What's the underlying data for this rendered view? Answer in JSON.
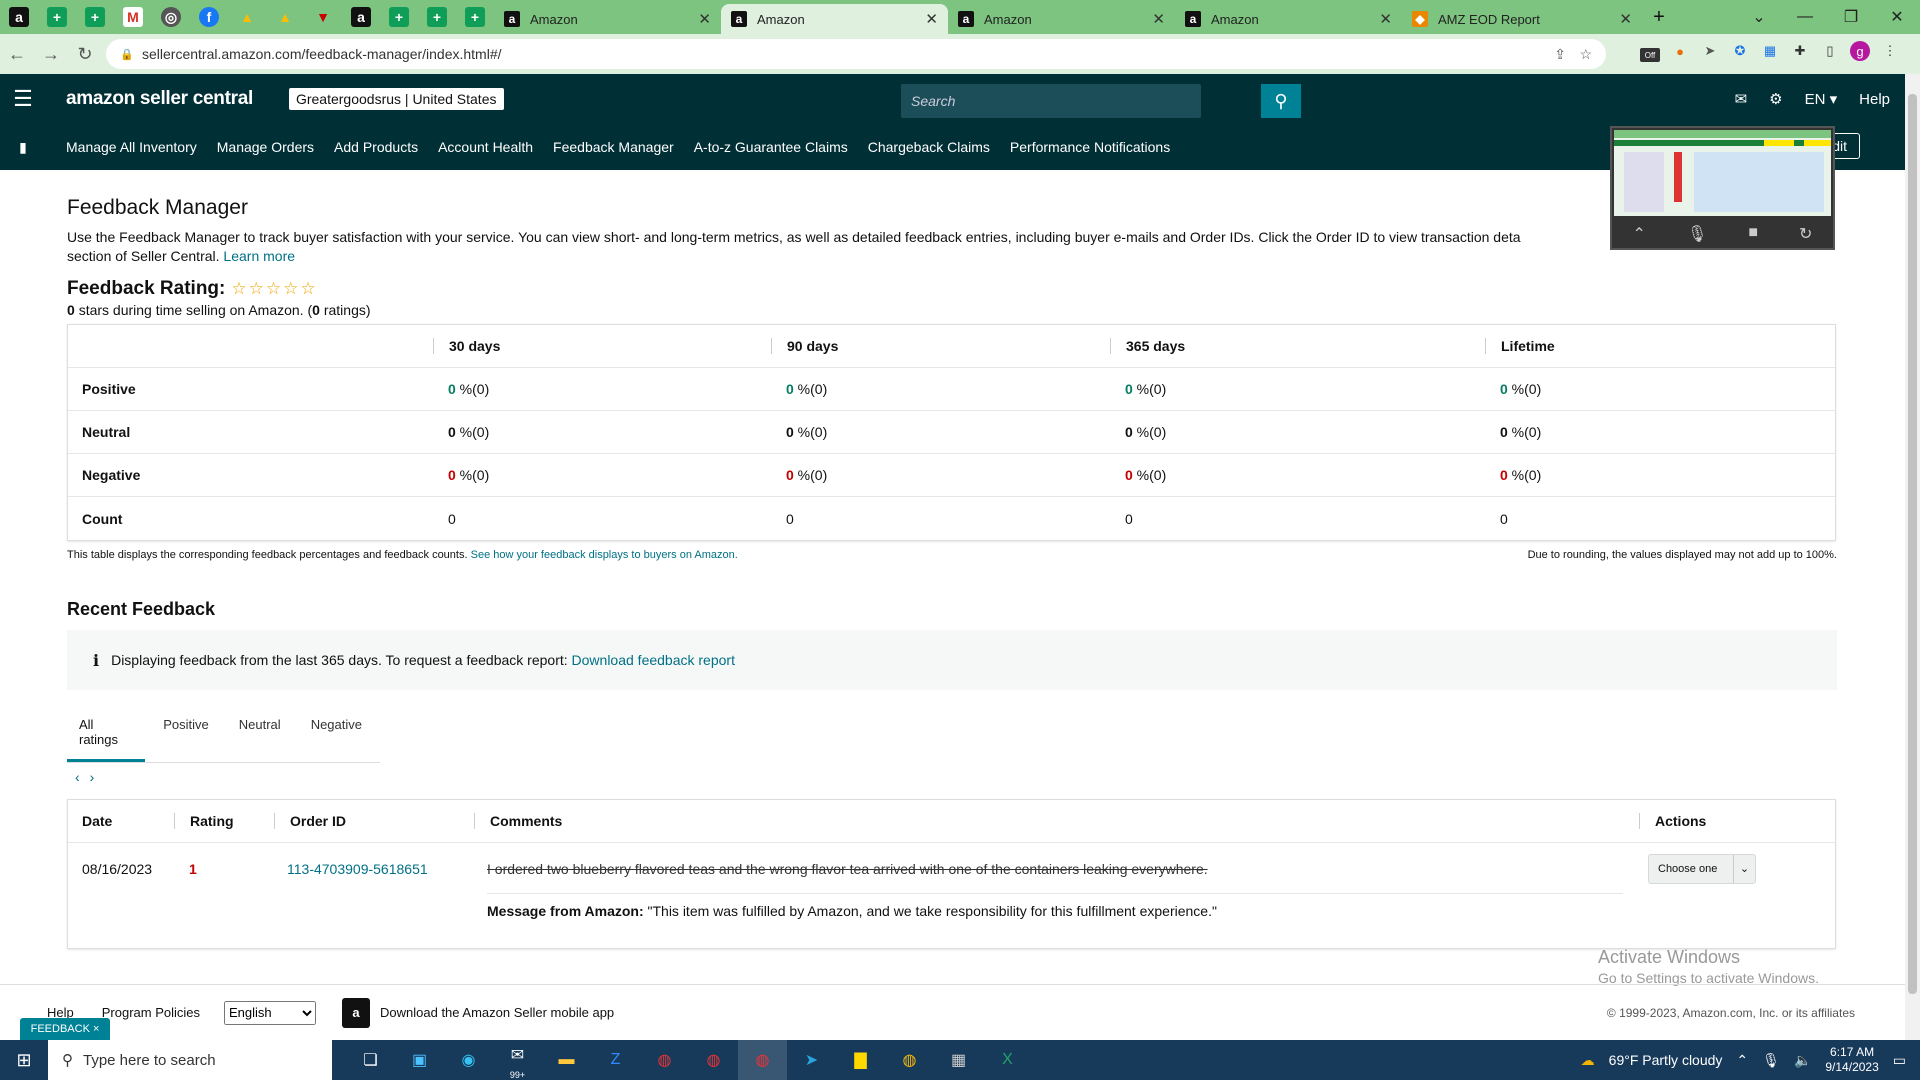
{
  "browser": {
    "tabs": [
      {
        "title": "Amazon",
        "active": false
      },
      {
        "title": "Amazon",
        "active": true
      },
      {
        "title": "Amazon",
        "active": false
      },
      {
        "title": "Amazon",
        "active": false
      },
      {
        "title": "AMZ EOD Report",
        "active": false
      }
    ],
    "url": "sellercentral.amazon.com/feedback-manager/index.html#/",
    "profile_initial": "g",
    "off_badge": "Off"
  },
  "header": {
    "logo": "amazon seller central",
    "account": "Greatergoodsrus | United States",
    "search_placeholder": "Search",
    "language": "EN",
    "help": "Help"
  },
  "nav": {
    "items": [
      "Manage All Inventory",
      "Manage Orders",
      "Add Products",
      "Account Health",
      "Feedback Manager",
      "A-to-z Guarantee Claims",
      "Chargeback Claims",
      "Performance Notifications"
    ],
    "edit": "Edit"
  },
  "page": {
    "title": "Feedback Manager",
    "description": "Use the Feedback Manager to track buyer satisfaction with your service. You can view short- and long-term metrics, as well as detailed feedback entries, including buyer e-mails and Order IDs. Click the Order ID to view transaction deta",
    "description_tail": "section of Seller Central.",
    "learn_more": "Learn more",
    "rating_label": "Feedback Rating:",
    "rating_stars": 0,
    "rating_sub_value": "0",
    "rating_sub_text": "stars during time selling on Amazon. (",
    "rating_count": "0",
    "rating_sub_end": "ratings)"
  },
  "metrics": {
    "columns": [
      "30 days",
      "90 days",
      "365 days",
      "Lifetime"
    ],
    "rows": [
      {
        "label": "Positive",
        "type": "pos",
        "values": [
          "0",
          "0",
          "0",
          "0"
        ],
        "suffix": " %(0)"
      },
      {
        "label": "Neutral",
        "type": "neu",
        "values": [
          "0",
          "0",
          "0",
          "0"
        ],
        "suffix": " %(0)"
      },
      {
        "label": "Negative",
        "type": "neg",
        "values": [
          "0",
          "0",
          "0",
          "0"
        ],
        "suffix": " %(0)"
      },
      {
        "label": "Count",
        "type": "count",
        "values": [
          "0",
          "0",
          "0",
          "0"
        ],
        "suffix": ""
      }
    ],
    "note_left": "This table displays the corresponding feedback percentages and feedback counts.",
    "note_link": "See how your feedback displays to buyers on Amazon.",
    "note_right": "Due to rounding, the values displayed may not add up to 100%."
  },
  "recent": {
    "title": "Recent Feedback",
    "info_text": "Displaying feedback from the last 365 days. To request a feedback report:",
    "info_link": "Download feedback report",
    "tabs": [
      "All ratings",
      "Positive",
      "Neutral",
      "Negative"
    ],
    "columns": [
      "Date",
      "Rating",
      "Order ID",
      "Comments",
      "Actions"
    ],
    "rows": [
      {
        "date": "08/16/2023",
        "rating": "1",
        "order_id": "113-4703909-5618651",
        "comment": "I ordered two blueberry flavored teas and the wrong flavor tea arrived with one of the containers leaking everywhere.",
        "message_label": "Message from Amazon:",
        "message": "\"This item was fulfilled by Amazon, and we take responsibility for this fulfillment experience.\"",
        "action": "Choose one"
      }
    ]
  },
  "watermark": {
    "line1": "Activate Windows",
    "line2": "Go to Settings to activate Windows."
  },
  "footer": {
    "help": "Help",
    "policies": "Program Policies",
    "language": "English",
    "app": "Download the Amazon Seller mobile app",
    "copyright": "© 1999-2023, Amazon.com, Inc. or its affiliates",
    "feedback_tag": "FEEDBACK ×"
  },
  "taskbar": {
    "search_placeholder": "Type here to search",
    "mail_badge": "99+",
    "weather": "69°F  Partly cloudy",
    "time": "6:17 AM",
    "date": "9/14/2023"
  }
}
